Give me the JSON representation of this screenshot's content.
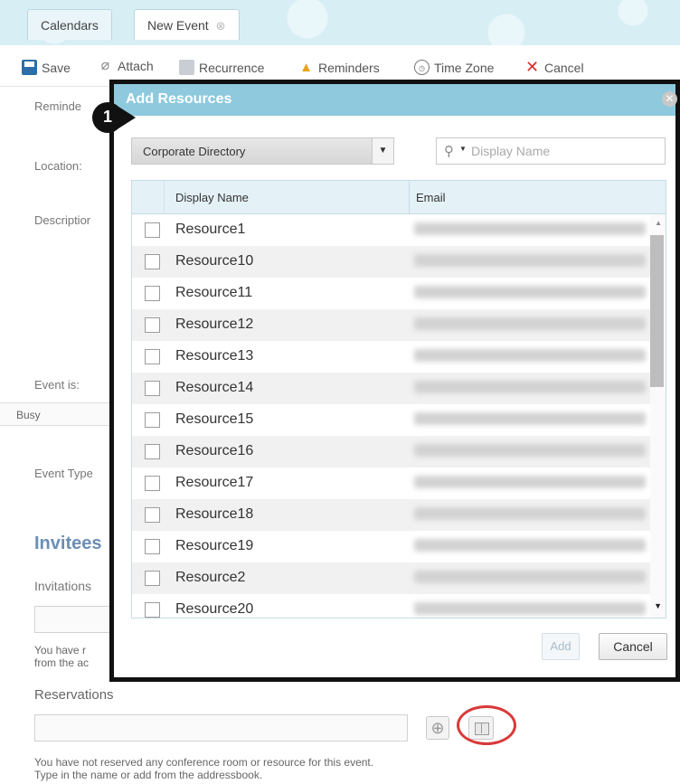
{
  "tabs": [
    {
      "label": "Calendars"
    },
    {
      "label": "New Event",
      "close_icon": "⊗"
    }
  ],
  "toolbar": {
    "save": "Save",
    "attach": "Attach",
    "recurrence": "Recurrence",
    "reminders": "Reminders",
    "time_zone": "Time Zone",
    "cancel": "Cancel"
  },
  "form": {
    "reminders_label": "Reminde",
    "location_label": "Location:",
    "description_label": "Descriptior",
    "event_is_label": "Event is:",
    "busy_value": "Busy",
    "event_type_label": "Event Type",
    "invitees_heading": "Invitees",
    "invitations_label": "Invitations",
    "invitees_note_line1": "You have r",
    "invitees_note_line2": "from the ac",
    "reservations_label": "Reservations",
    "reservation_note_line1": "You have not reserved any conference room or resource for this event.",
    "reservation_note_line2": "Type in the name or add from the addressbook."
  },
  "modal": {
    "title": "Add Resources",
    "callout_number": "1",
    "directory_select": "Corporate Directory",
    "search_placeholder": "Display Name",
    "columns": {
      "display_name": "Display Name",
      "email": "Email"
    },
    "rows": [
      {
        "name": "Resource1"
      },
      {
        "name": "Resource10"
      },
      {
        "name": "Resource11"
      },
      {
        "name": "Resource12"
      },
      {
        "name": "Resource13"
      },
      {
        "name": "Resource14"
      },
      {
        "name": "Resource15"
      },
      {
        "name": "Resource16"
      },
      {
        "name": "Resource17"
      },
      {
        "name": "Resource18"
      },
      {
        "name": "Resource19"
      },
      {
        "name": "Resource2"
      },
      {
        "name": "Resource20"
      }
    ],
    "add_button": "Add",
    "cancel_button": "Cancel"
  },
  "colors": {
    "header_bar": "#8ec9dd",
    "tab_background": "#d7eef5",
    "invitees_heading": "#6b8eb5",
    "highlight_circle": "#d93a3a",
    "cancel_icon": "#d9302c"
  },
  "icons": {
    "save": "save-icon",
    "attach": "paperclip-icon",
    "recurrence": "recurrence-icon",
    "reminders": "bell-icon",
    "time_zone": "clock-icon",
    "cancel": "x-icon",
    "modal_close": "close-icon",
    "search": "search-icon",
    "add_reservation": "plus-icon",
    "addressbook": "addressbook-icon"
  }
}
